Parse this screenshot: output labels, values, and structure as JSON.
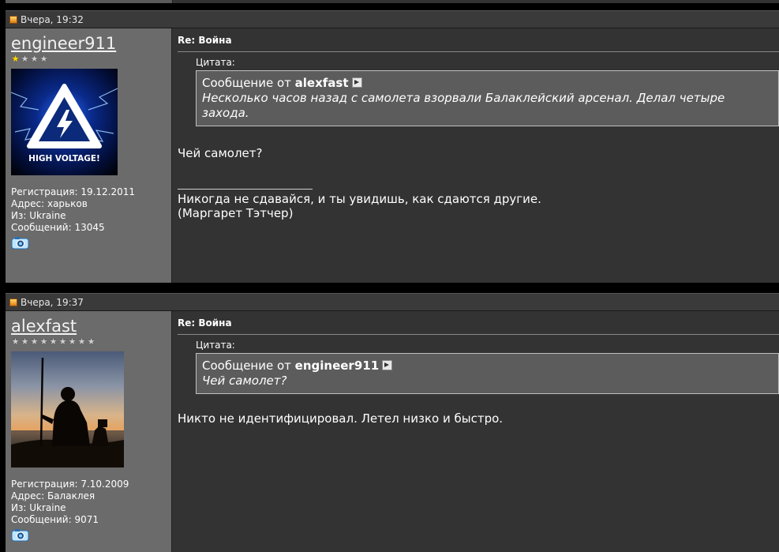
{
  "posts": [
    {
      "timestamp": "Вчера, 19:32",
      "username": "engineer911",
      "stars_gold": 1,
      "stars_total": 4,
      "avatar_caption": "HIGH VOLTAGE!",
      "info": {
        "registration": "Регистрация: 19.12.2011",
        "address": "Адрес: харьков",
        "from": "Из: Ukraine",
        "messages": "Сообщений: 13045"
      },
      "title": "Re: Война",
      "quote_label": "Цитата:",
      "quote_prefix": "Сообщение от",
      "quote_author": "alexfast",
      "quote_text": "Несколько часов назад с самолета взорвали Балаклейский арсенал. Делал четыре захода.",
      "message": "Чей самолет?",
      "signature": [
        "Никогда не сдавайся, и ты увидишь, как сдаются другие.",
        "(Маргарет Тэтчер)"
      ]
    },
    {
      "timestamp": "Вчера, 19:37",
      "username": "alexfast",
      "stars_gold": 0,
      "stars_total": 9,
      "info": {
        "registration": "Регистрация: 7.10.2009",
        "address": "Адрес: Балаклея",
        "from": "Из: Ukraine",
        "messages": "Сообщений: 9071"
      },
      "title": "Re: Война",
      "quote_label": "Цитата:",
      "quote_prefix": "Сообщение от",
      "quote_author": "engineer911",
      "quote_text": "Чей самолет?",
      "message": "Никто не идентифицировал. Летел низко и быстро."
    }
  ],
  "colors": {
    "user_panel": "#6b6b6b",
    "message_panel": "#333333",
    "header_bar": "#3a3a3a",
    "quote_box": "#5c5c5c",
    "star_gold": "#ffd700"
  }
}
